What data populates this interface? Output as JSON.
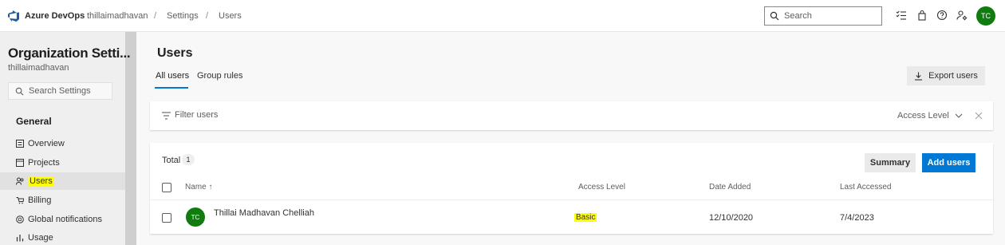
{
  "topbar": {
    "brand": "Azure DevOps",
    "breadcrumbs": [
      "thillaimadhavan",
      "Settings",
      "Users"
    ],
    "separators": [
      "/",
      "/"
    ],
    "search_placeholder": "Search",
    "user_initials": "TC",
    "icons": [
      "task-list-icon",
      "shopping-bag-icon",
      "help-icon",
      "user-settings-icon"
    ]
  },
  "sidebar": {
    "org_title": "Organization Setti...",
    "org_name": "thillaimadhavan",
    "search_placeholder": "Search Settings",
    "section": "General",
    "items": [
      {
        "label": "Overview",
        "icon": "overview-icon"
      },
      {
        "label": "Projects",
        "icon": "projects-icon"
      },
      {
        "label": "Users",
        "icon": "users-icon",
        "active": true,
        "highlighted": true
      },
      {
        "label": "Billing",
        "icon": "billing-icon"
      },
      {
        "label": "Global notifications",
        "icon": "notifications-icon"
      },
      {
        "label": "Usage",
        "icon": "usage-icon"
      }
    ]
  },
  "main": {
    "title": "Users",
    "tabs": [
      {
        "label": "All users",
        "active": true
      },
      {
        "label": "Group rules",
        "active": false
      }
    ],
    "export_label": "Export users",
    "filter": {
      "placeholder": "Filter users",
      "access_level_label": "Access Level"
    },
    "users": {
      "total_label": "Total",
      "total_count": "1",
      "summary_label": "Summary",
      "add_label": "Add users",
      "columns": {
        "name": "Name ↑",
        "access_level": "Access Level",
        "date_added": "Date Added",
        "last_accessed": "Last Accessed"
      },
      "rows": [
        {
          "initials": "TC",
          "name": "Thillai Madhavan Chelliah",
          "access_level": "Basic",
          "date_added": "12/10/2020",
          "last_accessed": "7/4/2023"
        }
      ]
    }
  },
  "colors": {
    "accent": "#0078d4",
    "avatar": "#107c10",
    "highlight": "#ffff00"
  }
}
